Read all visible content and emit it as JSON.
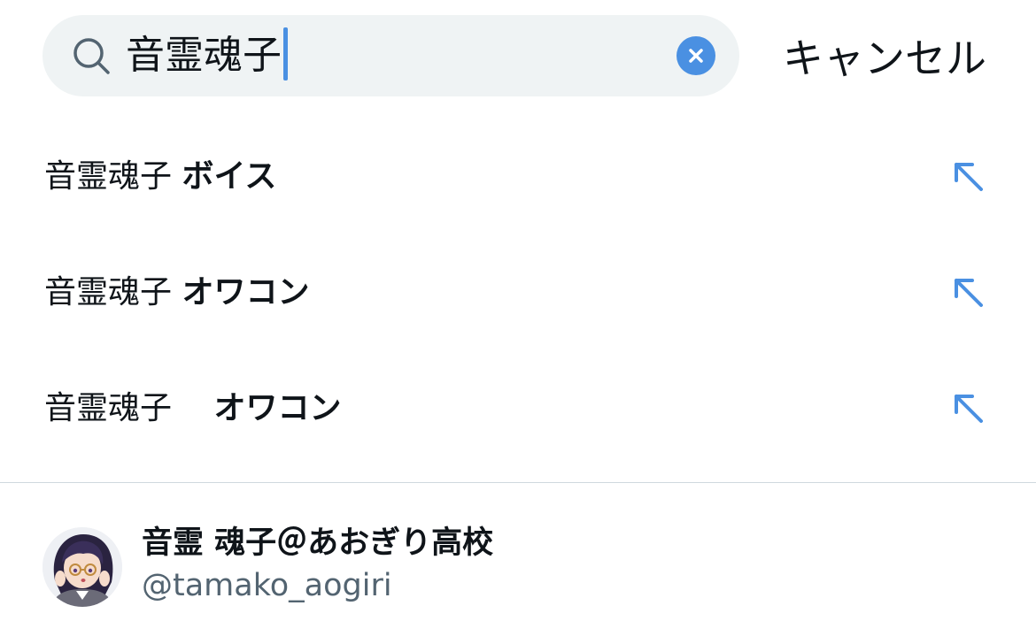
{
  "search": {
    "query": "音霊魂子",
    "icon": "search-icon",
    "clear_icon": "close-icon",
    "cancel_label": "キャンセル",
    "accent_color": "#4a90e2"
  },
  "suggestions": [
    {
      "prefix": "音霊魂子 ",
      "suffix": "ボイス",
      "icon": "arrow-up-left-icon"
    },
    {
      "prefix": "音霊魂子 ",
      "suffix": "オワコン",
      "icon": "arrow-up-left-icon"
    },
    {
      "prefix": "音霊魂子　 ",
      "suffix": "オワコン",
      "icon": "arrow-up-left-icon"
    }
  ],
  "user_result": {
    "name": "音霊 魂子＠あおぎり高校",
    "handle": "@tamako_aogiri",
    "avatar": "avatar"
  }
}
